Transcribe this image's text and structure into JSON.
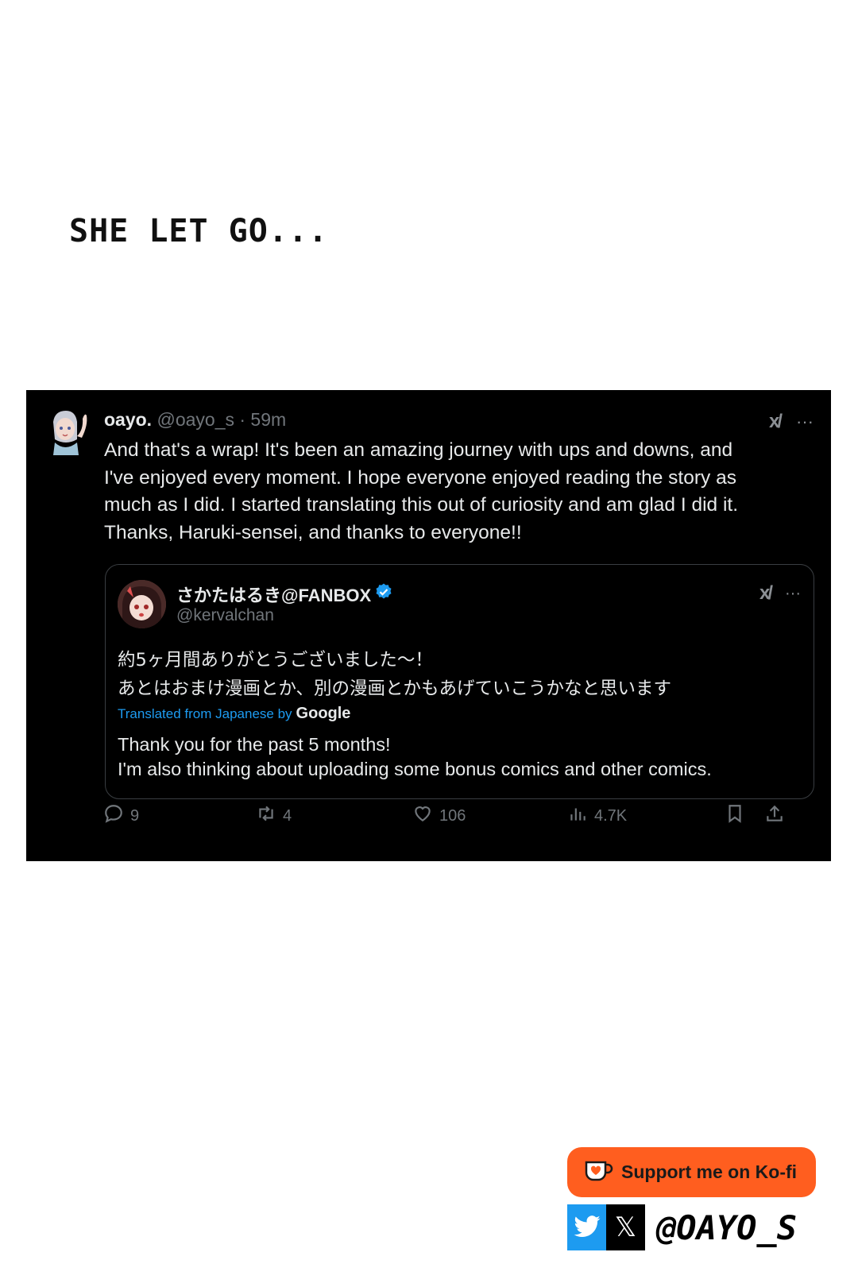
{
  "caption": "SHE LET GO...",
  "tweet": {
    "author_name": "oayo.",
    "author_handle": "@oayo_s",
    "time": " · 59m",
    "grok_label": "x/",
    "more_label": "···",
    "body_lines": [
      "And that's a wrap! It's been an amazing journey with ups and downs, and",
      "I've enjoyed every moment. I hope everyone enjoyed reading the story as",
      "much as I did. I started translating this out of curiosity and am glad I did it.",
      "Thanks, Haruki-sensei, and thanks to everyone!!"
    ],
    "quote": {
      "name": "さかたはるき@FANBOX",
      "handle": "@kervalchan",
      "jp_lines": [
        "約5ヶ月間ありがとうございました～！",
        "あとはおまけ漫画とか、別の漫画とかもあげていこうかなと思います"
      ],
      "translated_label": "Translated from Japanese by",
      "translated_brand": "Google",
      "en_lines": [
        "Thank you for the past 5 months!",
        "I'm also thinking about uploading some bonus comics and other comics."
      ]
    },
    "stats": {
      "replies": "9",
      "reposts": "4",
      "likes": "106",
      "views": "4.7K"
    }
  },
  "kofi_label": "Support me on Ko-fi",
  "social_handle": "@OAYO_S",
  "x_glyph": "𝕏",
  "colors": {
    "tweet_bg": "#000000",
    "link_blue": "#1d9bf0",
    "kofi_orange": "#ff5e1f",
    "twitter_blue": "#1d9bf0"
  }
}
